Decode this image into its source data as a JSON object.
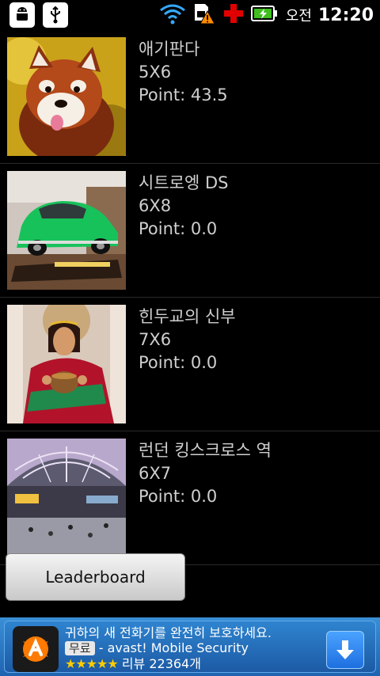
{
  "status_bar": {
    "left_icons": [
      "android-debug-icon",
      "usb-icon"
    ],
    "right_icons": [
      "wifi-icon",
      "sim-warning-icon",
      "red-cross-icon",
      "battery-charging-icon"
    ],
    "ampm": "오전",
    "time": "12:20"
  },
  "puzzles": [
    {
      "title": "애기판다",
      "size": "5X6",
      "point": "Point: 43.5",
      "thumb": "red-panda-thumbnail"
    },
    {
      "title": "시트로엥 DS",
      "size": "6X8",
      "point": "Point: 0.0",
      "thumb": "green-car-thumbnail"
    },
    {
      "title": "힌두교의 신부",
      "size": "7X6",
      "point": "Point: 0.0",
      "thumb": "hindu-bride-thumbnail"
    },
    {
      "title": "런던 킹스크로스 역",
      "size": "6X7",
      "point": "Point: 0.0",
      "thumb": "kings-cross-station-thumbnail"
    }
  ],
  "leaderboard_button": "Leaderboard",
  "ad": {
    "headline": "귀하의 새 전화기를 완전히 보호하세요.",
    "free_badge": "무료",
    "app_name": "- avast! Mobile Security",
    "stars": "★★★★★",
    "reviews": "리뷰 22364개"
  }
}
